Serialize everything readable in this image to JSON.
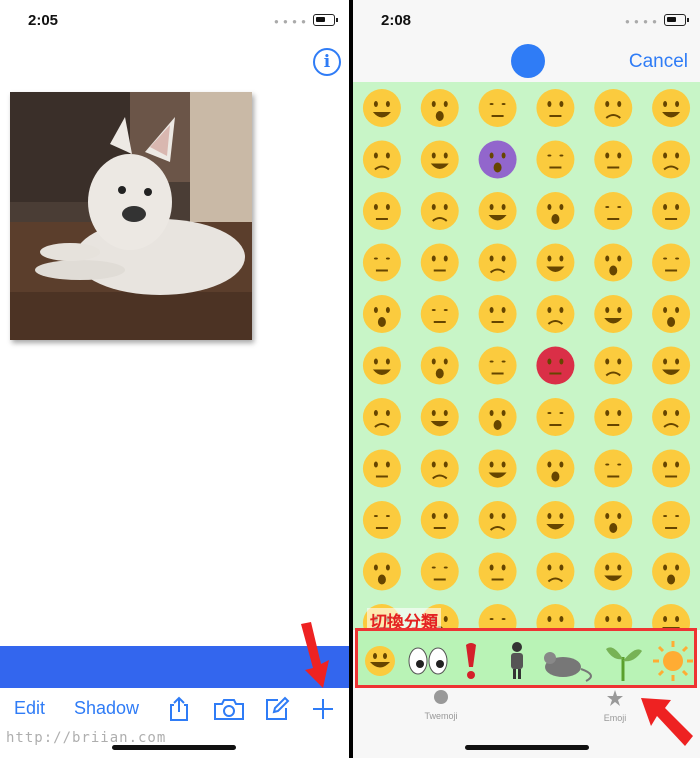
{
  "left_phone": {
    "status_time": "2:05",
    "toolbar": {
      "edit_label": "Edit",
      "shadow_label": "Shadow"
    },
    "watermark": "http://briian.com"
  },
  "right_phone": {
    "status_time": "2:08",
    "cancel_label": "Cancel",
    "category_label": "切換分類",
    "categories": [
      "smiley",
      "eyes",
      "exclamation",
      "person",
      "mouse",
      "plant",
      "sun"
    ],
    "tabs": [
      {
        "label": "Twemoji",
        "icon": "circle-icon"
      },
      {
        "label": "Emoji",
        "icon": "star-icon"
      }
    ]
  },
  "colors": {
    "accent": "#2f7cf6",
    "bar_blue": "#3366ee",
    "grid_bg": "#c8f5c7",
    "emoji_face": "#fbcb3e",
    "highlight_red": "#e33333"
  }
}
